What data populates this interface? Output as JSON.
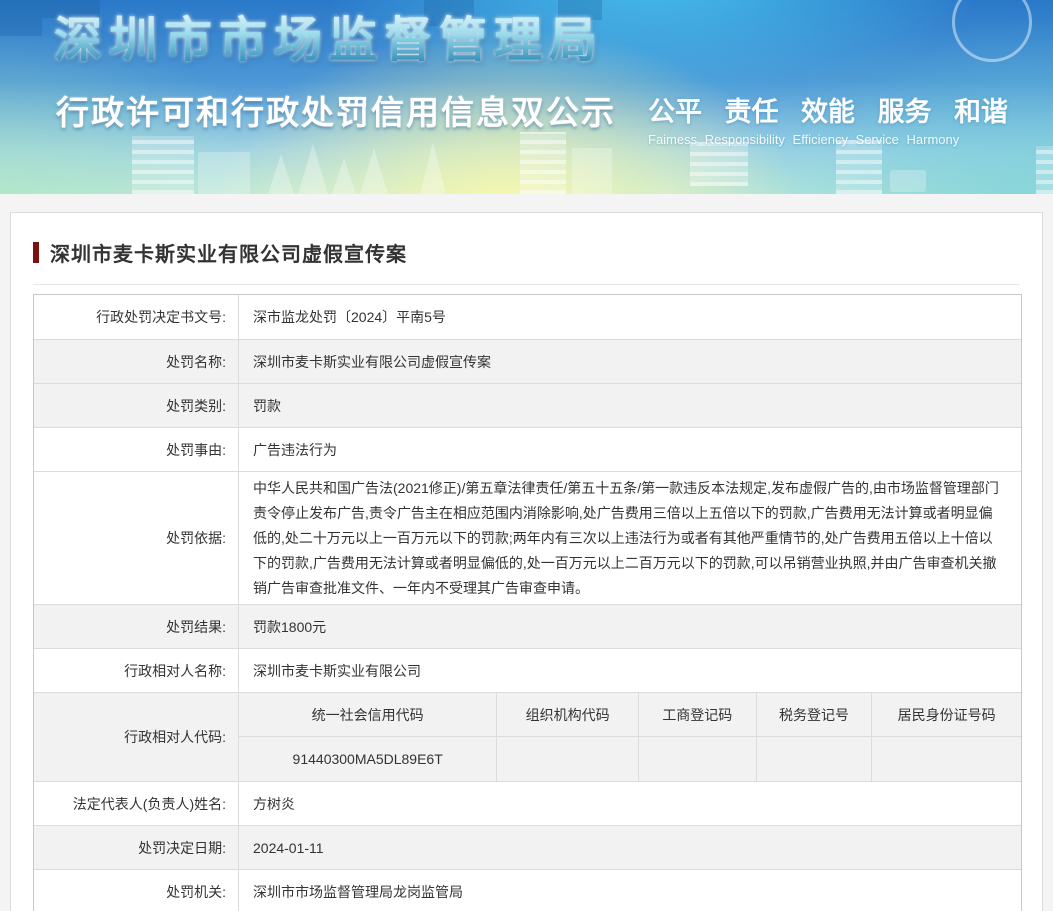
{
  "banner": {
    "title": "深圳市市场监督管理局",
    "subtitle": "行政许可和行政处罚信用信息双公示",
    "slogan_cn": "公平 责任 效能 服务 和谐",
    "slogan_en": "Faimess Responsibility Efficiency Service Harmony",
    "colors": {
      "sky_blue": "#2a79c9",
      "glow_cyan": "#50d2f5",
      "glow_yellow": "#faf8aa",
      "teal": "#6ecdd7"
    }
  },
  "case": {
    "title": "深圳市麦卡斯实业有限公司虚假宣传案",
    "accent_color": "#7b1113"
  },
  "table": {
    "shaded_color": "#f2f2f2",
    "rows": [
      {
        "label": "行政处罚决定书文号:",
        "value": "深市监龙处罚〔2024〕平南5号"
      },
      {
        "label": "处罚名称:",
        "value": "深圳市麦卡斯实业有限公司虚假宣传案"
      },
      {
        "label": "处罚类别:",
        "value": "罚款"
      },
      {
        "label": "处罚事由:",
        "value": "广告违法行为"
      },
      {
        "label": "处罚依据:",
        "value": "中华人民共和国广告法(2021修正)/第五章法律责任/第五十五条/第一款违反本法规定,发布虚假广告的,由市场监督管理部门责令停止发布广告,责令广告主在相应范围内消除影响,处广告费用三倍以上五倍以下的罚款,广告费用无法计算或者明显偏低的,处二十万元以上一百万元以下的罚款;两年内有三次以上违法行为或者有其他严重情节的,处广告费用五倍以上十倍以下的罚款,广告费用无法计算或者明显偏低的,处一百万元以上二百万元以下的罚款,可以吊销营业执照,并由广告审查机关撤销广告审查批准文件、一年内不受理其广告审查申请。"
      },
      {
        "label": "处罚结果:",
        "value": "罚款1800元"
      },
      {
        "label": "行政相对人名称:",
        "value": "深圳市麦卡斯实业有限公司"
      },
      {
        "label": "法定代表人(负责人)姓名:",
        "value": "方树炎"
      },
      {
        "label": "处罚决定日期:",
        "value": "2024-01-11"
      },
      {
        "label": "处罚机关:",
        "value": "深圳市市场监督管理局龙岗监管局"
      }
    ],
    "code_row": {
      "label": "行政相对人代码:",
      "columns": [
        "统一社会信用代码",
        "组织机构代码",
        "工商登记码",
        "税务登记号",
        "居民身份证号码"
      ],
      "values": [
        "91440300MA5DL89E6T",
        "",
        "",
        "",
        ""
      ]
    }
  }
}
